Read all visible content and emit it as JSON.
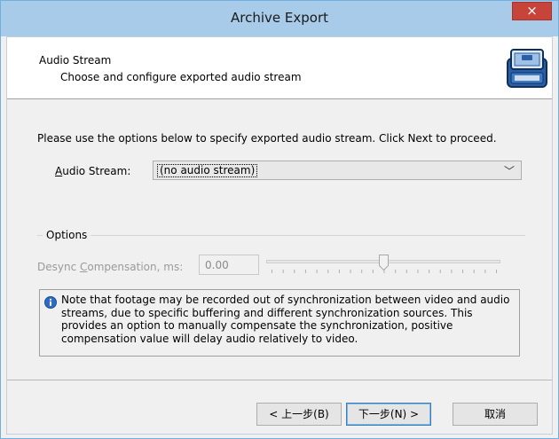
{
  "window": {
    "title": "Archive Export",
    "close_glyph": "×"
  },
  "header": {
    "title": "Audio Stream",
    "subtitle": "Choose and configure exported audio stream",
    "icon": "archive-case-icon"
  },
  "intro_text": "Please use the options below to specify exported audio stream. Click Next to proceed.",
  "audio_stream": {
    "label_mnemonic": "A",
    "label_rest": "udio Stream:",
    "value": "(no audio stream)",
    "chevron": "﹀"
  },
  "options": {
    "group_label": "Options",
    "desync_label_pre": "Desync ",
    "desync_label_mnemonic": "C",
    "desync_label_post": "ompensation, ms:",
    "desync_value": "0.00",
    "slider_fraction": 0.5,
    "slider_tick_count": 21
  },
  "note": {
    "icon": "info-icon",
    "text": "Note that footage may be recorded out of synchronization between video and audio streams, due to specific buffering and different synchronization sources. This provides an option to manually compensate the synchronization, positive compensation value will delay audio relatively to video."
  },
  "buttons": {
    "back": "< 上一步(B)",
    "next": "下一步(N) >",
    "cancel": "取消"
  },
  "colors": {
    "titlebar": "#a8cbea",
    "close": "#c7443a",
    "accent_border": "#3c7fb1"
  }
}
